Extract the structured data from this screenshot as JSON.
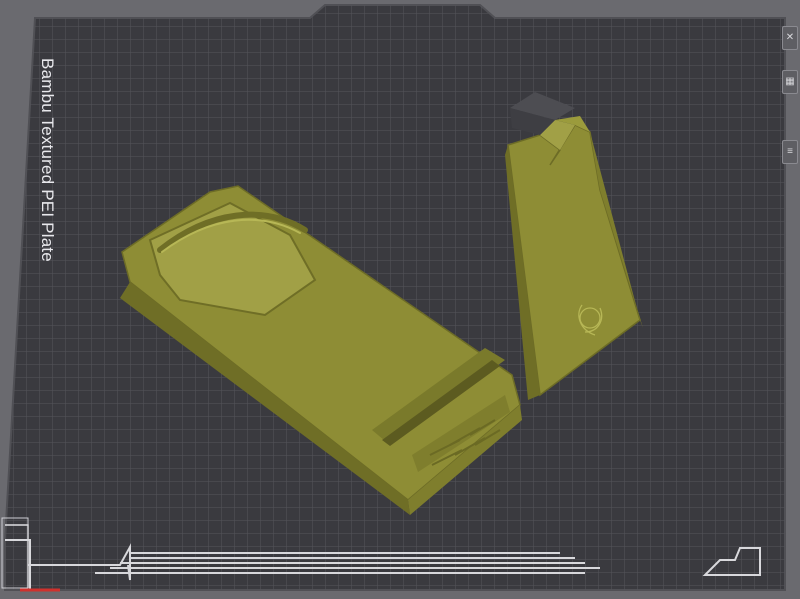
{
  "build_plate": {
    "label": "Bambu Textured PEI Plate"
  },
  "colors": {
    "background": "#6a6a6f",
    "plate": "#3a3a3f",
    "grid": "#55555b",
    "model": "#9b9b3c",
    "highlight": "#b7b756"
  },
  "icons": [
    "close-icon",
    "grid-icon",
    "slider-handle-icon"
  ],
  "side_toolbar": {
    "close": "✕",
    "grid": "▦",
    "slider": "≡"
  }
}
